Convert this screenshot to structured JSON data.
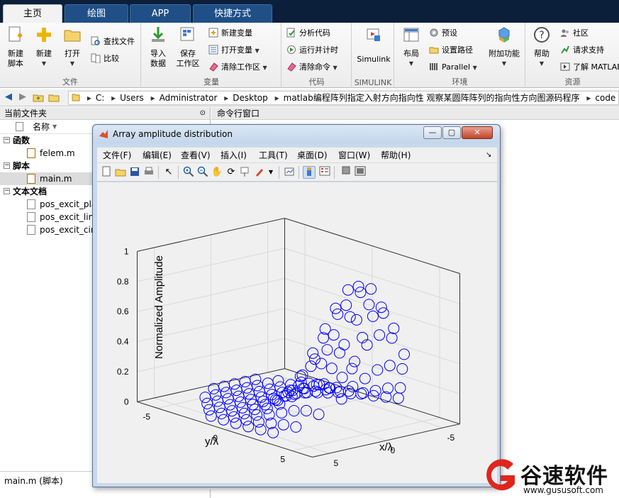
{
  "tabs": [
    {
      "label": "主页"
    },
    {
      "label": "绘图"
    },
    {
      "label": "APP"
    },
    {
      "label": "快捷方式"
    }
  ],
  "ribbon": {
    "file_group": {
      "label": "文件",
      "new_script": "新建\n脚本",
      "new": "新建",
      "open": "打开",
      "find_files": "查找文件",
      "compare": "比较"
    },
    "variable_group": {
      "label": "变量",
      "import_data": "导入\n数据",
      "save_workspace": "保存\n工作区",
      "new_variable": "新建变量",
      "open_variable": "打开变量",
      "clear_workspace": "清除工作区"
    },
    "code_group": {
      "label": "代码",
      "analyze_code": "分析代码",
      "run_time": "运行并计时",
      "clear_commands": "清除命令"
    },
    "simulink_group": {
      "label": "SIMULINK",
      "simulink": "Simulink"
    },
    "env_group": {
      "label": "环境",
      "layout": "布局",
      "preferences": "预设",
      "set_path": "设置路径",
      "parallel": "Parallel",
      "addons": "附加功能"
    },
    "resources_group": {
      "label": "资源",
      "help": "帮助",
      "community": "社区",
      "request_support": "请求支持",
      "learn_matlab": "了解 MATLAB"
    }
  },
  "address": {
    "segments": [
      "C:",
      "Users",
      "Administrator",
      "Desktop",
      "matlab编程阵列指定入射方向指向性 观察某圆阵阵列的指向性方向图源码程序",
      "code"
    ]
  },
  "left_panel": {
    "title": "当前文件夹",
    "name_col": "名称",
    "sections": [
      {
        "label": "函数",
        "items": [
          "felem.m"
        ]
      },
      {
        "label": "脚本",
        "items": [
          "main.m"
        ]
      },
      {
        "label": "文本文档",
        "items": [
          "pos_excit_pla",
          "pos_excit_line",
          "pos_excit_cir"
        ]
      }
    ],
    "status": "main.m  (脚本)"
  },
  "command_window": {
    "title": "命令行窗口"
  },
  "figure": {
    "title": "Array amplitude distribution",
    "menus": [
      "文件(F)",
      "编辑(E)",
      "查看(V)",
      "插入(I)",
      "工具(T)",
      "桌面(D)",
      "窗口(W)",
      "帮助(H)"
    ]
  },
  "chart_data": {
    "type": "scatter",
    "marker": "open-circle",
    "color": "#0000ff",
    "zlabel": "Normalized Amplitude",
    "xlabel": "x/λ",
    "ylabel": "y/λ",
    "zlim": [
      0,
      1
    ],
    "z_ticks": [
      "0",
      "0.2",
      "0.4",
      "0.6",
      "0.8",
      "1"
    ],
    "x_ticks": [
      "-5",
      "0",
      "5"
    ],
    "y_ticks": [
      "-5",
      "0",
      "5"
    ],
    "x_range": [
      -5.5,
      5.5
    ],
    "y_range": [
      -5.5,
      5.5
    ],
    "grid": true,
    "description_series": [
      {
        "label_y_center": 0,
        "n": 16,
        "peak": 1.0
      },
      {
        "label_y_center": 1,
        "n": 16,
        "peak": 0.6
      },
      {
        "label_y_center": 2,
        "n": 16,
        "peak": 0.35
      },
      {
        "label_y_center": 3,
        "n": 16,
        "peak": 0.2
      }
    ]
  },
  "logo": {
    "text": "谷速软件",
    "url": "www.gususoft.com",
    "brand_color": "#e0261c"
  }
}
